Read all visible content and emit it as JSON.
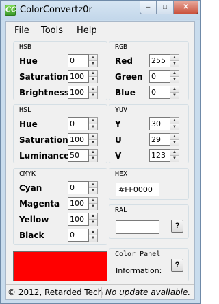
{
  "window": {
    "title": "ColorConvertz0r",
    "icon": "cc-app-icon",
    "icon_text": "CC",
    "caption_buttons": {
      "minimize": "–",
      "maximize": "□",
      "close": "✕"
    }
  },
  "menu": [
    "File",
    "Tools",
    "Help"
  ],
  "hsb": {
    "title": "HSB",
    "rows": [
      {
        "label": "Hue",
        "value": "0"
      },
      {
        "label": "Saturation",
        "value": "100"
      },
      {
        "label": "Brightness",
        "value": "100"
      }
    ]
  },
  "rgb": {
    "title": "RGB",
    "rows": [
      {
        "label": "Red",
        "value": "255"
      },
      {
        "label": "Green",
        "value": "0"
      },
      {
        "label": "Blue",
        "value": "0"
      }
    ]
  },
  "hsl": {
    "title": "HSL",
    "rows": [
      {
        "label": "Hue",
        "value": "0"
      },
      {
        "label": "Saturation",
        "value": "100"
      },
      {
        "label": "Luminance",
        "value": "50"
      }
    ]
  },
  "yuv": {
    "title": "YUV",
    "rows": [
      {
        "label": "Y",
        "value": "30"
      },
      {
        "label": "U",
        "value": "29"
      },
      {
        "label": "V",
        "value": "123"
      }
    ]
  },
  "cmyk": {
    "title": "CMYK",
    "rows": [
      {
        "label": "Cyan",
        "value": "0"
      },
      {
        "label": "Magenta",
        "value": "100"
      },
      {
        "label": "Yellow",
        "value": "100"
      },
      {
        "label": "Black",
        "value": "0"
      }
    ]
  },
  "hex": {
    "title": "HEX",
    "value": "#FF0000"
  },
  "ral": {
    "title": "RAL",
    "value": "",
    "help": "?"
  },
  "color_panel": {
    "title": "Color Panel",
    "info_label": "Information:",
    "help": "?"
  },
  "swatch": {
    "color": "#ff0000"
  },
  "status": {
    "copyright": "© 2012, Retarded Tech",
    "update": "No update available."
  },
  "colors": {
    "titlebar": "#c9dced",
    "client": "#f0f0f0",
    "close_button": "#c9513c"
  }
}
